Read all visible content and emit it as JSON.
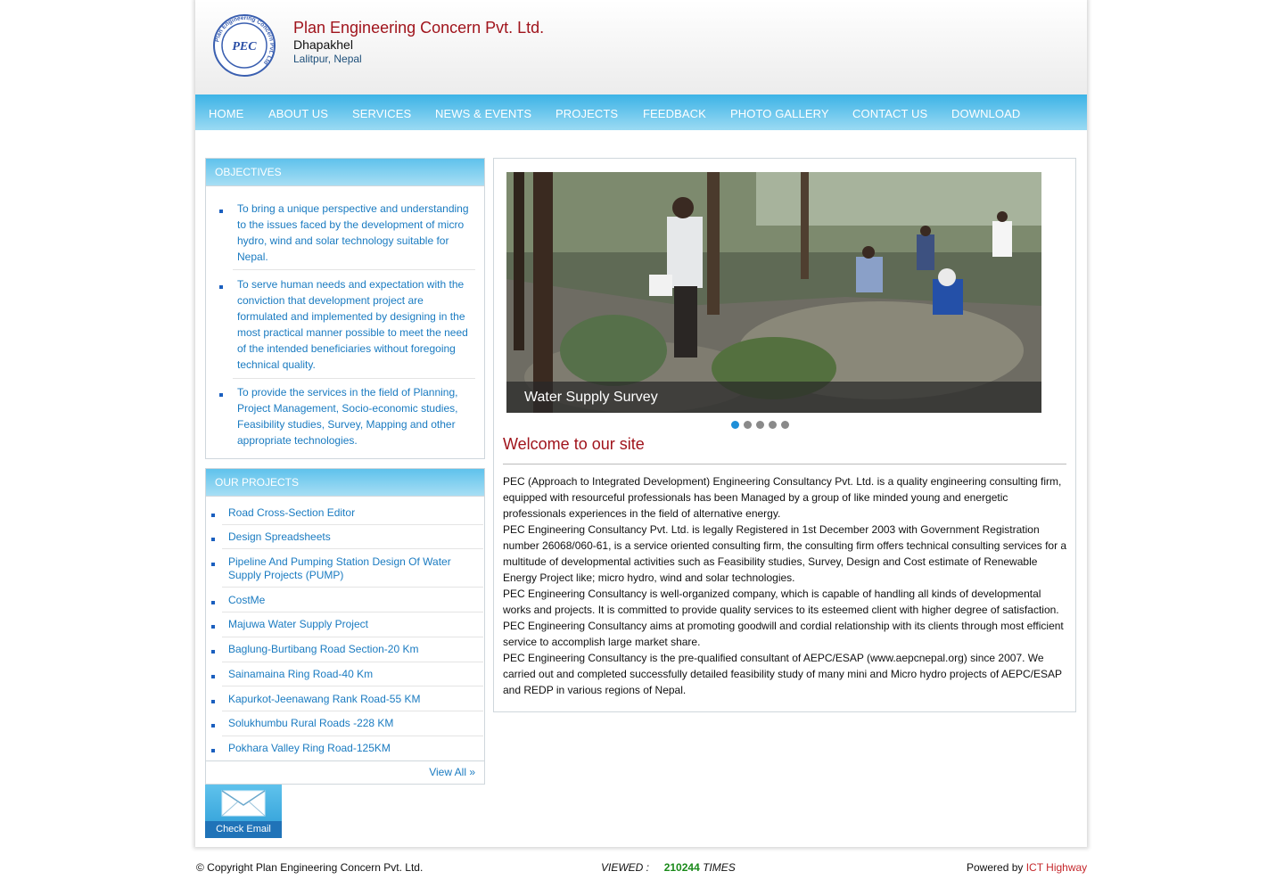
{
  "header": {
    "company_name": "Plan Engineering Concern Pvt. Ltd.",
    "address_line1": "Dhapakhel",
    "address_line2": "Lalitpur, Nepal",
    "logo_text": "PEC",
    "logo_ring_text": "Plan Engineering Concern Pvt. Ltd"
  },
  "nav": {
    "items": [
      "HOME",
      "ABOUT US",
      "SERVICES",
      "NEWS & EVENTS",
      "PROJECTS",
      "FEEDBACK",
      "PHOTO GALLERY",
      "CONTACT US",
      "DOWNLOAD"
    ]
  },
  "objectives": {
    "title": "OBJECTIVES",
    "items": [
      "To bring a unique perspective and understanding to the issues faced by the development of micro hydro, wind and solar technology suitable for Nepal.",
      "To serve human needs and expectation with the conviction that development project are formulated and implemented by designing in the most practical manner possible to meet the need of the intended beneficiaries without foregoing technical quality.",
      "To provide the services in the field of Planning, Project Management, Socio-economic studies, Feasibility studies, Survey, Mapping and other appropriate technologies."
    ]
  },
  "projects": {
    "title": "OUR PROJECTS",
    "items": [
      "Road Cross-Section Editor",
      "Design Spreadsheets",
      "Pipeline And Pumping Station Design Of Water Supply Projects (PUMP)",
      "CostMe",
      "Majuwa Water Supply Project",
      "Baglung-Burtibang Road Section-20 Km",
      "Sainamaina Ring Road-40 Km",
      "Kapurkot-Jeenawang Rank Road-55 KM",
      "Solukhumbu Rural Roads -228 KM",
      "Pokhara Valley Ring Road-125KM"
    ],
    "view_all": "View All »"
  },
  "check_email": {
    "label": "Check Email",
    "icon": "envelope-icon"
  },
  "slider": {
    "caption": "Water Supply Survey",
    "slide_count": 5,
    "active_index": 0
  },
  "welcome": {
    "title": "Welcome to our site",
    "paragraphs": [
      "PEC (Approach to Integrated Development) Engineering Consultancy Pvt. Ltd. is a quality engineering consulting firm, equipped with resourceful professionals has been Managed by a group of like minded young and energetic professionals experiences in the field of alternative energy.",
      "PEC Engineering Consultancy Pvt. Ltd. is legally Registered in 1st December 2003 with Government Registration number 26068/060-61, is a service oriented consulting firm, the consulting firm offers technical consulting services for a multitude of developmental activities such as Feasibility studies, Survey, Design and Cost estimate of Renewable Energy Project like; micro hydro, wind and solar technologies.",
      "PEC Engineering Consultancy is well-organized company, which is capable of handling all kinds of developmental works and projects. It is committed to provide quality services to its esteemed client with higher degree of satisfaction.",
      "PEC Engineering Consultancy aims at promoting goodwill and cordial relationship with its clients through most efficient service to accomplish large market share.",
      "PEC Engineering Consultancy is the pre-qualified consultant of AEPC/ESAP (www.aepcnepal.org) since 2007. We carried out and completed successfully detailed feasibility study of many mini and Micro hydro projects of AEPC/ESAP and REDP in various regions of Nepal."
    ]
  },
  "footer": {
    "copyright": "© Copyright Plan Engineering Concern Pvt. Ltd.",
    "viewed_label": "VIEWED :",
    "viewed_count": "210244",
    "viewed_suffix": "TIMES",
    "powered_by": "Powered by",
    "powered_link": "ICT Highway"
  },
  "colors": {
    "brand_red": "#a0141c",
    "link_blue": "#1a7bc1",
    "nav_top": "#3cb3e6",
    "nav_bottom": "#9bdaf3",
    "counter_green": "#1a8a1a",
    "active_dot": "#1e8fd8"
  }
}
